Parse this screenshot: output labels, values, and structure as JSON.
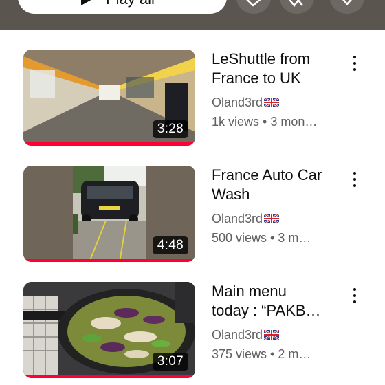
{
  "header": {
    "play_all_label": "Play all",
    "buttons": [
      {
        "icon": "shuffle-icon"
      },
      {
        "icon": "share-icon"
      },
      {
        "icon": "download-icon"
      }
    ]
  },
  "videos": [
    {
      "title_line1": "LeShuttle from",
      "title_line2": "France to UK",
      "channel": "Oland3rd",
      "flag": "uk-flag-icon",
      "stats": "1k views • 3 mon…",
      "duration": "3:28",
      "progress": 1.0,
      "thumbnail": "train-interior-image"
    },
    {
      "title_line1": "France Auto Car",
      "title_line2": "Wash",
      "channel": "Oland3rd",
      "flag": "uk-flag-icon",
      "stats": "500 views • 3 m…",
      "duration": "4:48",
      "progress": 1.0,
      "thumbnail": "car-wash-image"
    },
    {
      "title_line1": "Main menu",
      "title_line2": "today : “PAKB…",
      "channel": "Oland3rd",
      "flag": "uk-flag-icon",
      "stats": "375 views • 2 m…",
      "duration": "3:07",
      "progress": 1.0,
      "thumbnail": "cooking-pan-image"
    }
  ],
  "colors": {
    "header_bg": "#5b554f",
    "progress": "#ff0033",
    "text_primary": "#0f0f0f",
    "text_secondary": "#606060"
  }
}
